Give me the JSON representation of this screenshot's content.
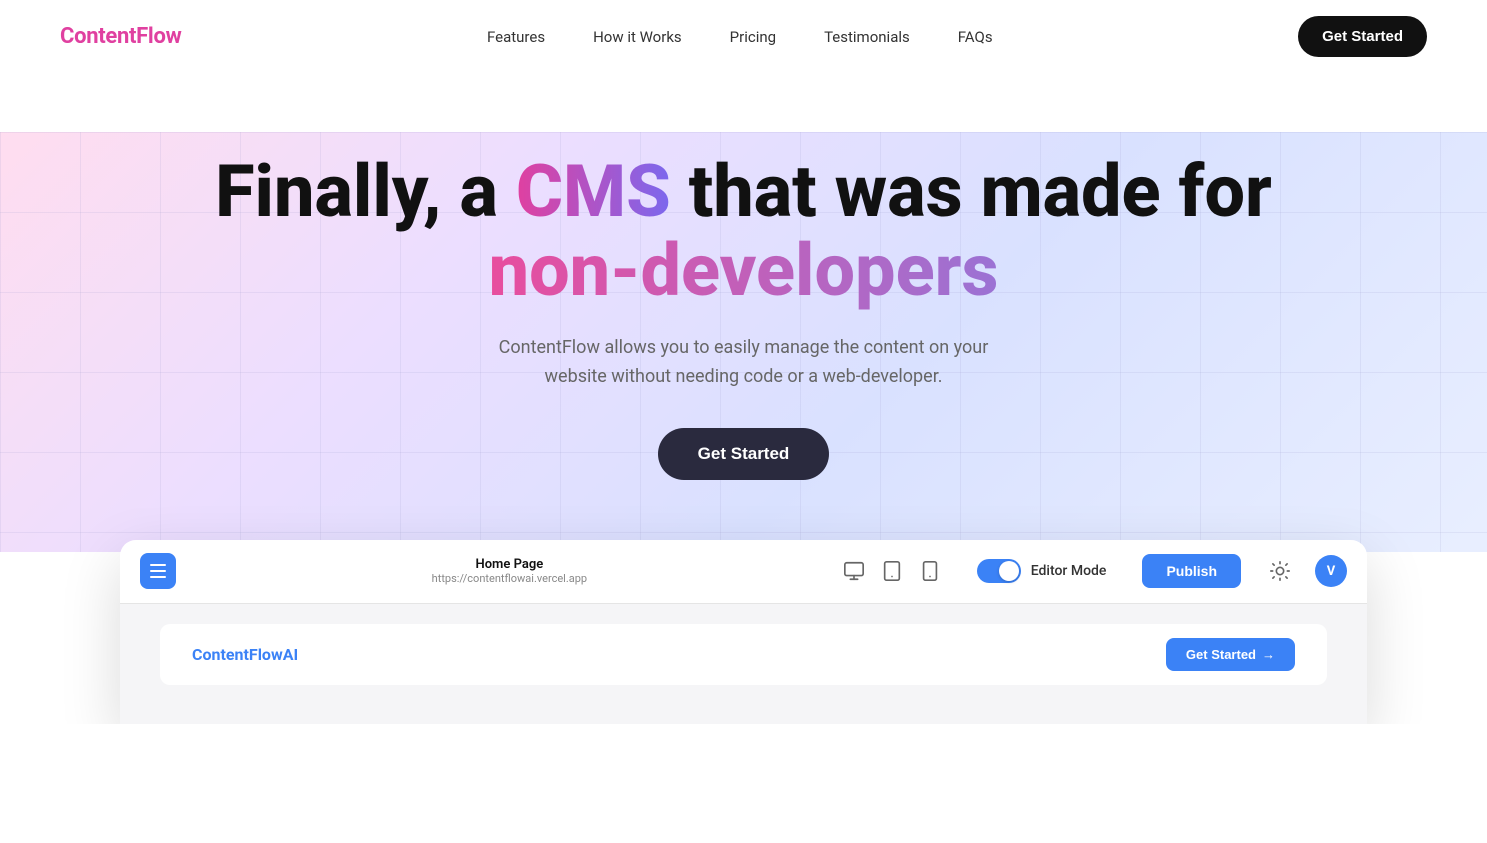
{
  "navbar": {
    "logo_text": "Content",
    "logo_highlight": "Flow",
    "nav_items": [
      {
        "label": "Features",
        "id": "features"
      },
      {
        "label": "How it Works",
        "id": "how-it-works"
      },
      {
        "label": "Pricing",
        "id": "pricing"
      },
      {
        "label": "Testimonials",
        "id": "testimonials"
      },
      {
        "label": "FAQs",
        "id": "faqs"
      }
    ],
    "cta_label": "Get Started"
  },
  "hero": {
    "title_prefix": "Finally, a ",
    "title_cms": "CMS",
    "title_middle": " that was made for ",
    "title_nondev": "non-developers",
    "subtitle": "ContentFlow allows you to easily manage the content on your website without needing code or a web-developer.",
    "cta_label": "Get Started"
  },
  "cms_preview": {
    "toolbar": {
      "page_title": "Home Page",
      "page_url": "https://contentflowai.vercel.app",
      "toggle_label": "Editor Mode",
      "publish_label": "Publish",
      "avatar_initial": "V"
    },
    "inner_website": {
      "logo_text": "ContentFlow",
      "logo_highlight": "AI",
      "cta_label": "Get Started",
      "cta_arrow": "→"
    }
  }
}
